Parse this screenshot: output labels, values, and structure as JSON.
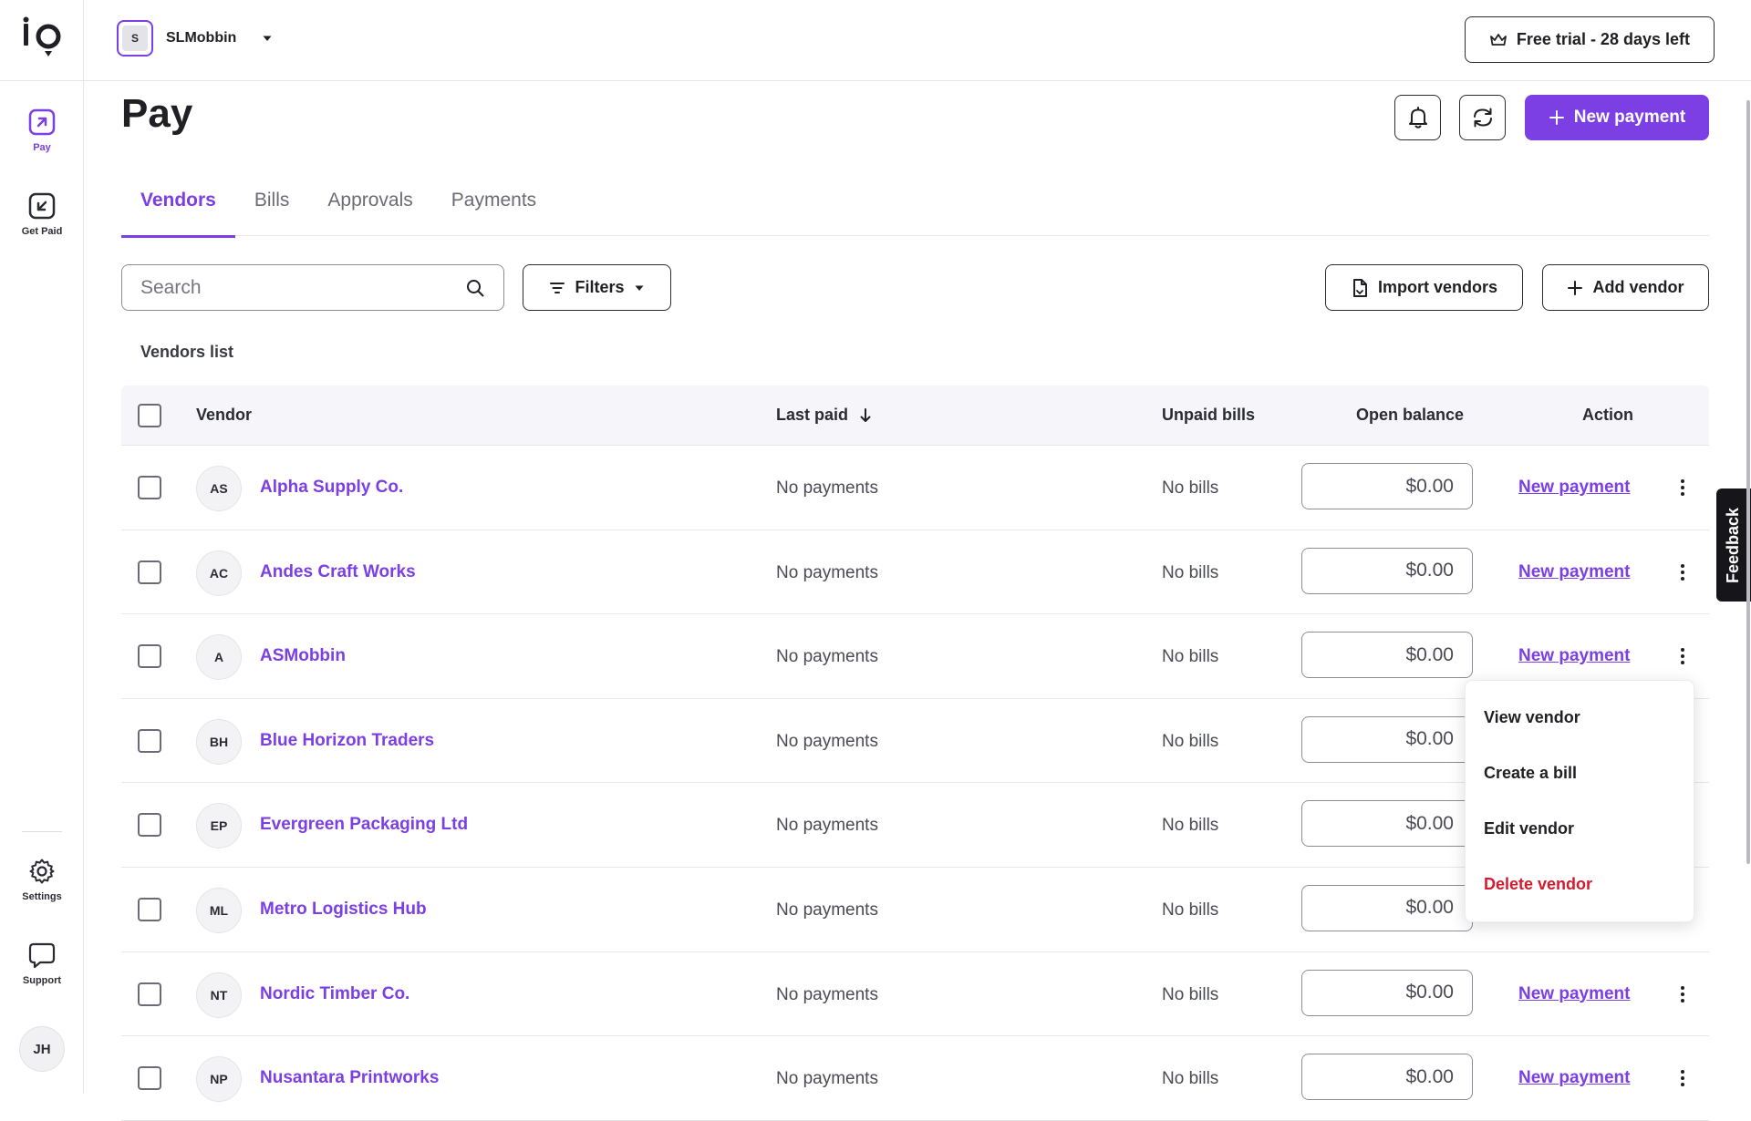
{
  "app": {
    "logo_text": "io"
  },
  "sidebar": {
    "items": [
      {
        "label": "Pay",
        "icon": "arrow-up-right-square-icon"
      },
      {
        "label": "Get Paid",
        "icon": "arrow-down-left-square-icon"
      }
    ],
    "bottom_items": [
      {
        "label": "Settings",
        "icon": "gear-icon"
      },
      {
        "label": "Support",
        "icon": "chat-bubble-icon"
      }
    ],
    "user_initials": "JH"
  },
  "topbar": {
    "org_initial": "S",
    "org_name": "SLMobbin",
    "trial_label": "Free trial - 28 days left"
  },
  "header": {
    "title": "Pay",
    "new_payment_label": "New payment"
  },
  "tabs": [
    {
      "label": "Vendors",
      "active": true
    },
    {
      "label": "Bills",
      "active": false
    },
    {
      "label": "Approvals",
      "active": false
    },
    {
      "label": "Payments",
      "active": false
    }
  ],
  "toolbar": {
    "search_placeholder": "Search",
    "filters_label": "Filters",
    "import_label": "Import vendors",
    "add_label": "Add vendor"
  },
  "list_caption": "Vendors list",
  "table": {
    "columns": {
      "vendor": "Vendor",
      "last_paid": "Last paid",
      "unpaid_bills": "Unpaid bills",
      "open_balance": "Open balance",
      "action": "Action"
    },
    "rows": [
      {
        "initials": "AS",
        "name": "Alpha Supply Co.",
        "last_paid": "No payments",
        "unpaid": "No bills",
        "balance": "$0.00",
        "action": "New payment"
      },
      {
        "initials": "AC",
        "name": "Andes Craft Works",
        "last_paid": "No payments",
        "unpaid": "No bills",
        "balance": "$0.00",
        "action": "New payment"
      },
      {
        "initials": "A",
        "name": "ASMobbin",
        "last_paid": "No payments",
        "unpaid": "No bills",
        "balance": "$0.00",
        "action": "New payment"
      },
      {
        "initials": "BH",
        "name": "Blue Horizon Traders",
        "last_paid": "No payments",
        "unpaid": "No bills",
        "balance": "$0.00",
        "action": ""
      },
      {
        "initials": "EP",
        "name": "Evergreen Packaging Ltd",
        "last_paid": "No payments",
        "unpaid": "No bills",
        "balance": "$0.00",
        "action": ""
      },
      {
        "initials": "ML",
        "name": "Metro Logistics Hub",
        "last_paid": "No payments",
        "unpaid": "No bills",
        "balance": "$0.00",
        "action": ""
      },
      {
        "initials": "NT",
        "name": "Nordic Timber Co.",
        "last_paid": "No payments",
        "unpaid": "No bills",
        "balance": "$0.00",
        "action": "New payment"
      },
      {
        "initials": "NP",
        "name": "Nusantara Printworks",
        "last_paid": "No payments",
        "unpaid": "No bills",
        "balance": "$0.00",
        "action": "New payment"
      }
    ]
  },
  "row_menu": {
    "items": [
      {
        "label": "View vendor"
      },
      {
        "label": "Create a bill"
      },
      {
        "label": "Edit vendor"
      },
      {
        "label": "Delete vendor"
      }
    ]
  },
  "feedback_label": "Feedback",
  "colors": {
    "accent": "#7b3fe4",
    "danger": "#d41a2e",
    "header_bg": "#f6f6fa"
  }
}
